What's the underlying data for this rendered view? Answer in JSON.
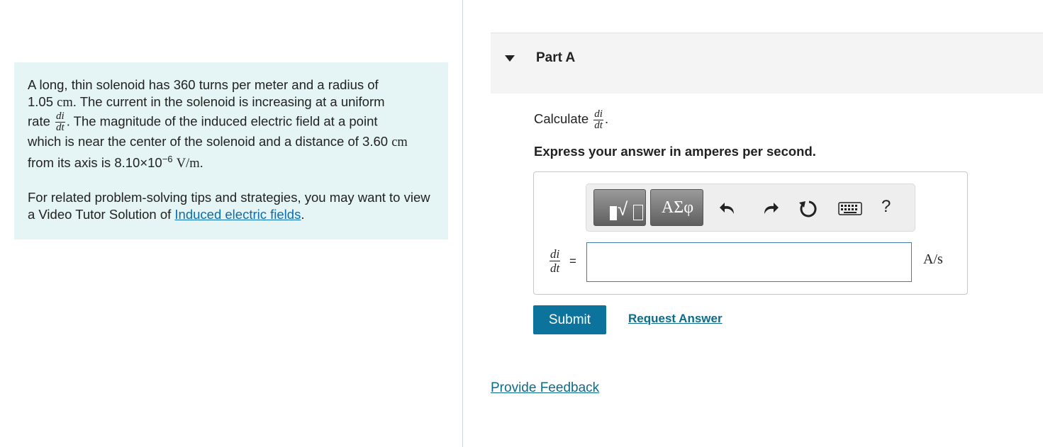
{
  "problem": {
    "line1": "A long, thin solenoid has 360 turns per meter and a radius of",
    "radius_value": "1.05",
    "radius_unit": "cm",
    "line2_rest": ". The current in the solenoid is increasing at a uniform",
    "rate_word": "rate",
    "frac_num": "di",
    "frac_den": "dt",
    "line3_rest": ". The magnitude of the induced electric field at a point",
    "line4": "which is near the center of the solenoid and a distance of 3.60",
    "distance_unit": "cm",
    "line5_prefix": "from its axis is 8.10×10",
    "exponent": "−6",
    "field_unit": "V/m",
    "period": ".",
    "tips_text": "For related problem-solving tips and strategies, you may want to view a Video Tutor Solution of",
    "tips_link": "Induced electric fields",
    "tips_end": "."
  },
  "part": {
    "title": "Part A",
    "calculate_label": "Calculate",
    "calc_num": "di",
    "calc_den": "dt",
    "calc_period": ".",
    "instruction": "Express your answer in amperes per second."
  },
  "answer": {
    "lhs_num": "di",
    "lhs_den": "dt",
    "equals": "=",
    "value": "",
    "units": "A/s"
  },
  "toolbar": {
    "symbols_label": "ΑΣφ",
    "help_label": "?",
    "icons": [
      "templates-icon",
      "symbols-icon",
      "undo-icon",
      "redo-icon",
      "reset-icon",
      "keyboard-icon",
      "help-icon"
    ]
  },
  "actions": {
    "submit_label": "Submit",
    "request_label": "Request Answer",
    "feedback_label": "Provide Feedback"
  },
  "colors": {
    "panel_bg": "#e5f4f4",
    "submit_bg": "#0b739c",
    "link": "#0b6cb0"
  }
}
